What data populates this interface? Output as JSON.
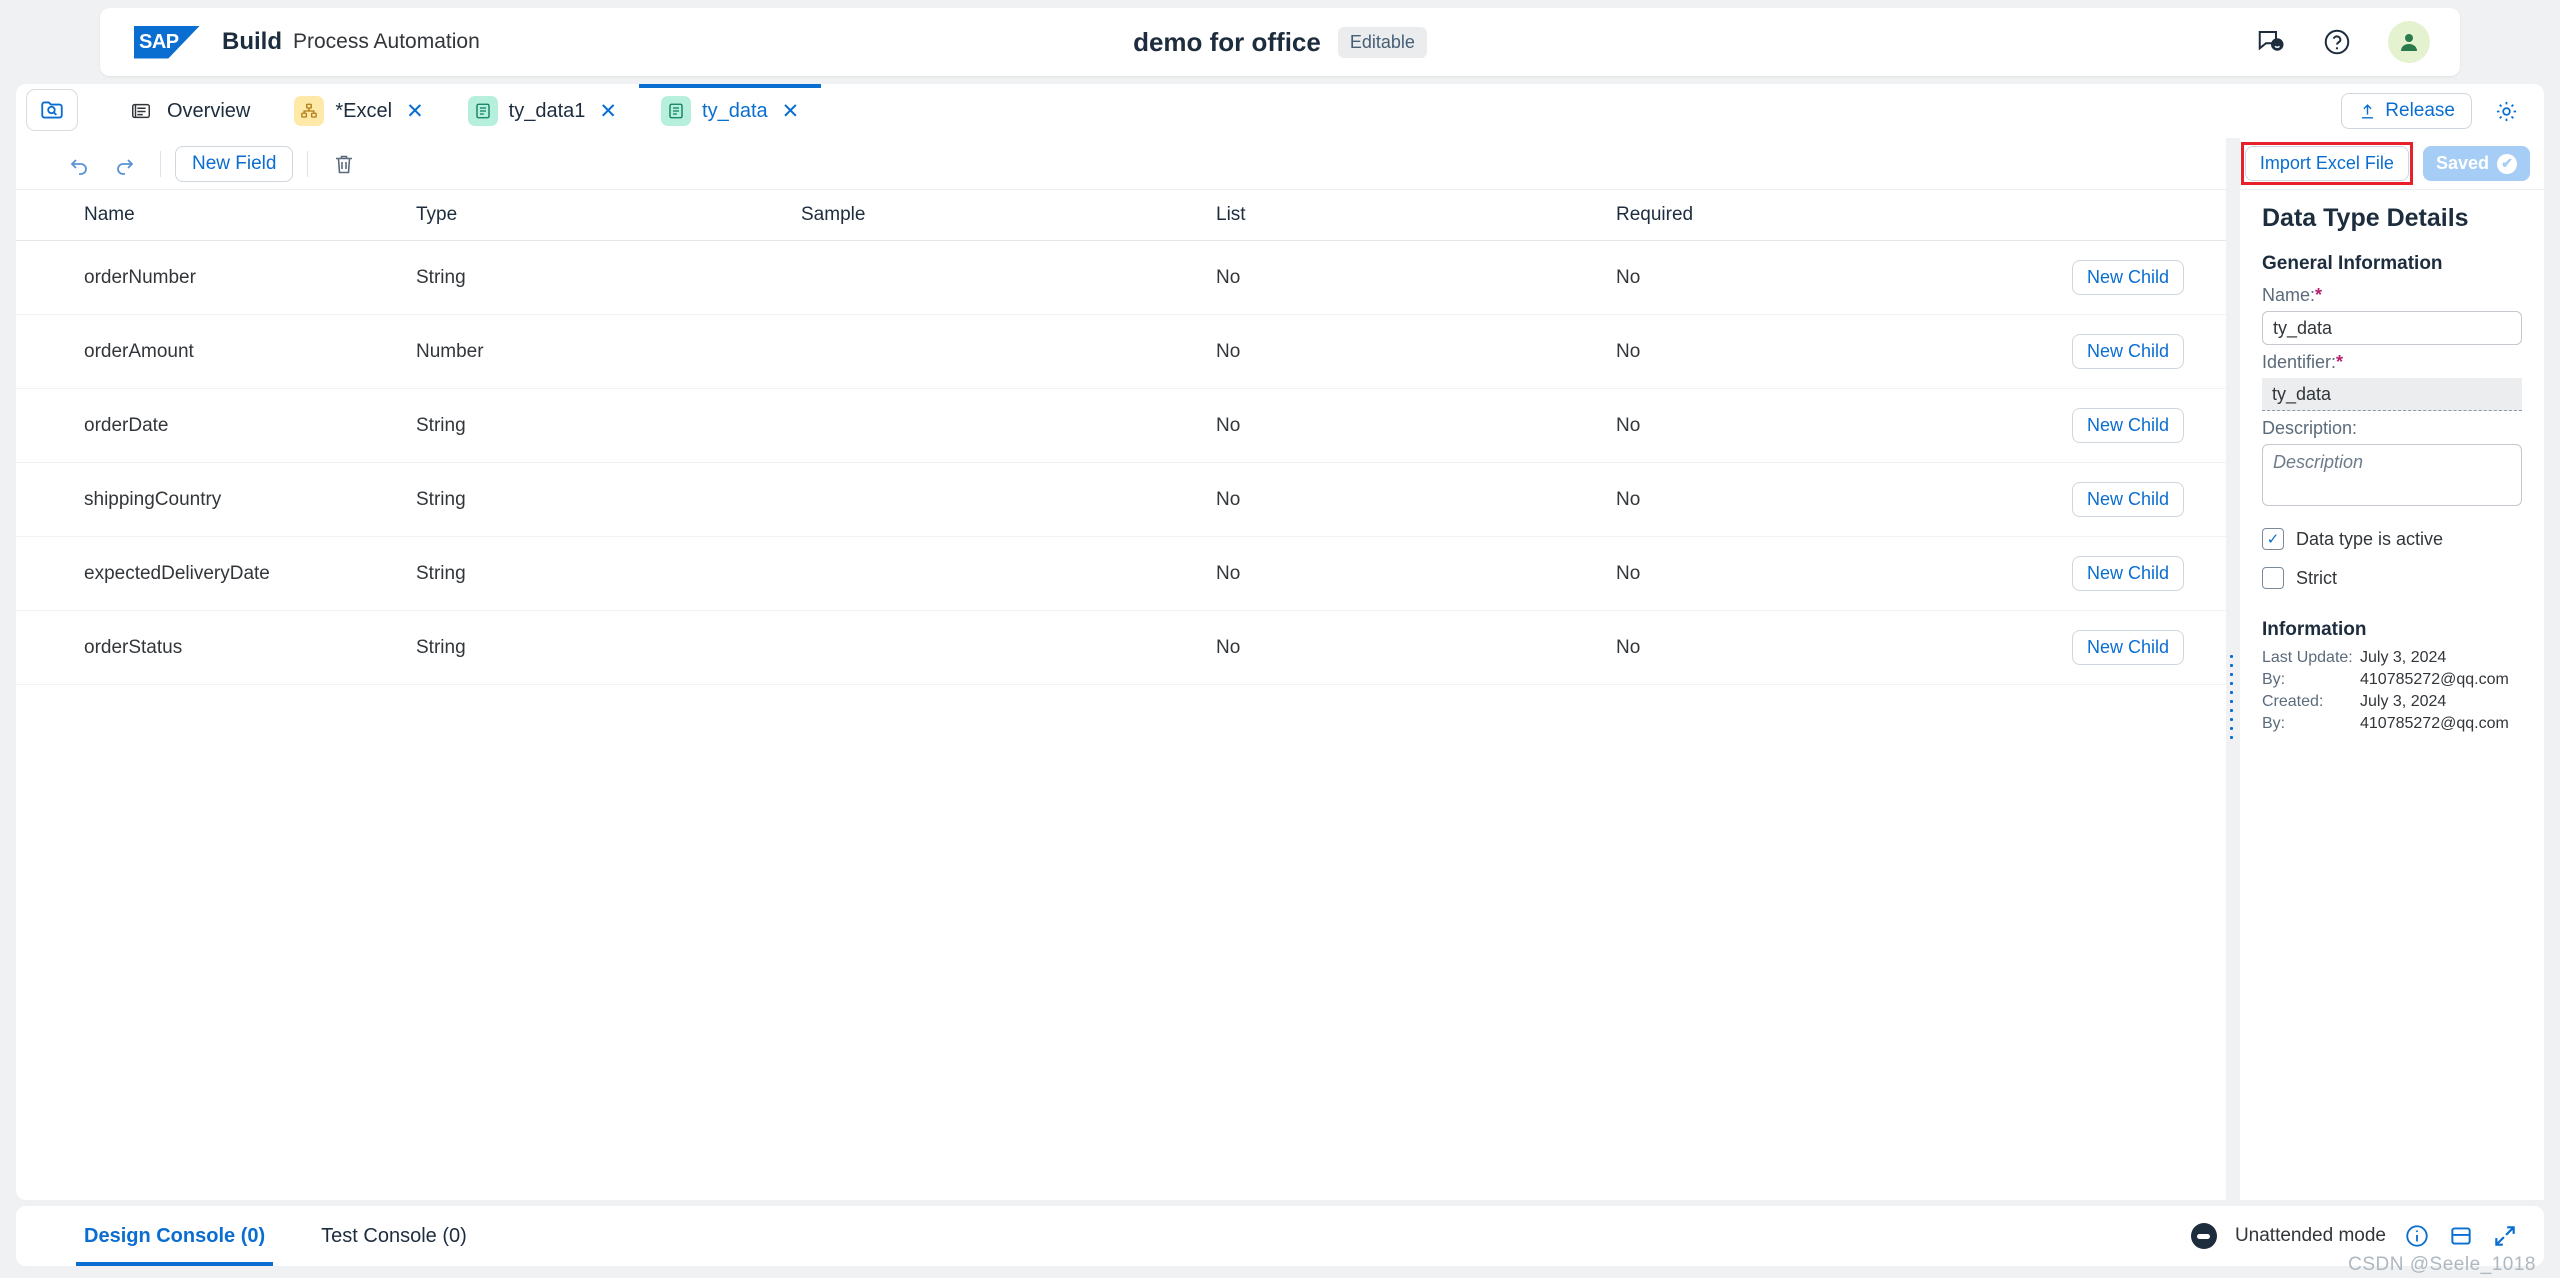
{
  "header": {
    "brand_name": "Build",
    "brand_subtitle": "Process Automation",
    "app_title": "demo for office",
    "editable_badge": "Editable",
    "icons": {
      "feedback": "feedback-icon",
      "help": "help-icon",
      "avatar": "user-avatar"
    }
  },
  "tabbar": {
    "explorer_icon": "explorer-search-icon",
    "tabs": [
      {
        "label": "Overview",
        "icon": "overview-document-icon",
        "icon_style": "plain",
        "active": false,
        "closable": false
      },
      {
        "label": "*Excel",
        "icon": "automation-icon",
        "icon_style": "yellow",
        "active": false,
        "closable": true
      },
      {
        "label": "ty_data1",
        "icon": "data-type-icon",
        "icon_style": "teal",
        "active": false,
        "closable": true
      },
      {
        "label": "ty_data",
        "icon": "data-type-icon",
        "icon_style": "teal",
        "active": true,
        "closable": true
      }
    ],
    "release_label": "Release",
    "settings_icon": "gear-icon"
  },
  "toolbar": {
    "undo_icon": "undo-icon",
    "redo_icon": "redo-icon",
    "new_field_label": "New Field",
    "delete_icon": "trash-icon"
  },
  "table": {
    "columns": [
      "Name",
      "Type",
      "Sample",
      "List",
      "Required"
    ],
    "action_label": "New Child",
    "rows": [
      {
        "name": "orderNumber",
        "type": "String",
        "sample": "",
        "list": "No",
        "required": "No"
      },
      {
        "name": "orderAmount",
        "type": "Number",
        "sample": "",
        "list": "No",
        "required": "No"
      },
      {
        "name": "orderDate",
        "type": "String",
        "sample": "",
        "list": "No",
        "required": "No"
      },
      {
        "name": "shippingCountry",
        "type": "String",
        "sample": "",
        "list": "No",
        "required": "No"
      },
      {
        "name": "expectedDeliveryDate",
        "type": "String",
        "sample": "",
        "list": "No",
        "required": "No"
      },
      {
        "name": "orderStatus",
        "type": "String",
        "sample": "",
        "list": "No",
        "required": "No"
      }
    ]
  },
  "details": {
    "import_button": "Import Excel File",
    "saved_badge": "Saved",
    "panel_title": "Data Type Details",
    "general_heading": "General Information",
    "name_label": "Name:",
    "name_value": "ty_data",
    "identifier_label": "Identifier:",
    "identifier_value": "ty_data",
    "description_label": "Description:",
    "description_value": "",
    "description_placeholder": "Description",
    "active_checkbox_label": "Data type is active",
    "active_checked": true,
    "strict_checkbox_label": "Strict",
    "strict_checked": false,
    "information_heading": "Information",
    "info_rows": [
      {
        "key": "Last Update:",
        "value": "July 3, 2024"
      },
      {
        "key": "By:",
        "value": "410785272@qq.com"
      },
      {
        "key": "Created:",
        "value": "July 3, 2024"
      },
      {
        "key": "By:",
        "value": "410785272@qq.com"
      }
    ]
  },
  "bottombar": {
    "design_console": "Design Console (0)",
    "test_console": "Test Console (0)",
    "unattended_mode": "Unattended mode",
    "info_icon": "info-icon",
    "panel_icon": "panel-toggle-icon",
    "expand_icon": "expand-icon"
  },
  "watermark": "CSDN @Seele_1018",
  "colors": {
    "accent": "#0a6ed1",
    "highlight": "#e8202a",
    "page_bg": "#eff1f2"
  }
}
